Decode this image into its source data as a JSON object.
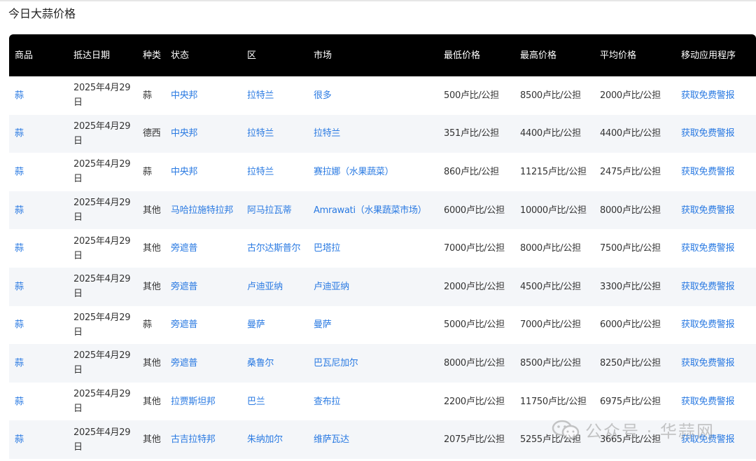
{
  "page": {
    "title": "今日大蒜价格"
  },
  "table": {
    "headers": [
      "商品",
      "抵达日期",
      "种类",
      "状态",
      "区",
      "市场",
      "最低价格",
      "最高价格",
      "平均价格",
      "移动应用程序"
    ],
    "rows": [
      {
        "commodity": "蒜",
        "date": "2025年4月29日",
        "variety": "蒜",
        "state": "中央邦",
        "district": "拉特兰",
        "market": "很多",
        "min": "500卢比/公担",
        "max": "8500卢比/公担",
        "avg": "2000卢比/公担",
        "app": "获取免费警报"
      },
      {
        "commodity": "蒜",
        "date": "2025年4月29日",
        "variety": "德西",
        "state": "中央邦",
        "district": "拉特兰",
        "market": "拉特兰",
        "min": "351卢比/公担",
        "max": "4400卢比/公担",
        "avg": "4400卢比/公担",
        "app": "获取免费警报"
      },
      {
        "commodity": "蒜",
        "date": "2025年4月29日",
        "variety": "蒜",
        "state": "中央邦",
        "district": "拉特兰",
        "market": "赛拉娜（水果蔬菜）",
        "min": "860卢比/公担",
        "max": "11215卢比/公担",
        "avg": "2475卢比/公担",
        "app": "获取免费警报"
      },
      {
        "commodity": "蒜",
        "date": "2025年4月29日",
        "variety": "其他",
        "state": "马哈拉施特拉邦",
        "district": "阿马拉瓦蒂",
        "market": "Amrawati（水果蔬菜市场）",
        "min": "6000卢比/公担",
        "max": "10000卢比/公担",
        "avg": "8000卢比/公担",
        "app": "获取免费警报"
      },
      {
        "commodity": "蒜",
        "date": "2025年4月29日",
        "variety": "其他",
        "state": "旁遮普",
        "district": "古尔达斯普尔",
        "market": "巴塔拉",
        "min": "7000卢比/公担",
        "max": "8000卢比/公担",
        "avg": "7500卢比/公担",
        "app": "获取免费警报"
      },
      {
        "commodity": "蒜",
        "date": "2025年4月29日",
        "variety": "其他",
        "state": "旁遮普",
        "district": "卢迪亚纳",
        "market": "卢迪亚纳",
        "min": "2000卢比/公担",
        "max": "4500卢比/公担",
        "avg": "3300卢比/公担",
        "app": "获取免费警报"
      },
      {
        "commodity": "蒜",
        "date": "2025年4月29日",
        "variety": "蒜",
        "state": "旁遮普",
        "district": "曼萨",
        "market": "曼萨",
        "min": "5000卢比/公担",
        "max": "7000卢比/公担",
        "avg": "6000卢比/公担",
        "app": "获取免费警报"
      },
      {
        "commodity": "蒜",
        "date": "2025年4月29日",
        "variety": "其他",
        "state": "旁遮普",
        "district": "桑鲁尔",
        "market": "巴瓦尼加尔",
        "min": "8000卢比/公担",
        "max": "8500卢比/公担",
        "avg": "8250卢比/公担",
        "app": "获取免费警报"
      },
      {
        "commodity": "蒜",
        "date": "2025年4月29日",
        "variety": "其他",
        "state": "拉贾斯坦邦",
        "district": "巴兰",
        "market": "查布拉",
        "min": "2200卢比/公担",
        "max": "11750卢比/公担",
        "avg": "6975卢比/公担",
        "app": "获取免费警报"
      },
      {
        "commodity": "蒜",
        "date": "2025年4月29日",
        "variety": "其他",
        "state": "古吉拉特邦",
        "district": "朱纳加尔",
        "market": "维萨瓦达",
        "min": "2075卢比/公担",
        "max": "5255卢比/公担",
        "avg": "3665卢比/公担",
        "app": "获取免费警报"
      }
    ]
  },
  "watermark": {
    "text": "公众号 · 华蒜网",
    "icon": "wechat-icon"
  },
  "colors": {
    "header_bg": "#000000",
    "link": "#2a7ae2",
    "row_alt": "#f4f6f9"
  }
}
